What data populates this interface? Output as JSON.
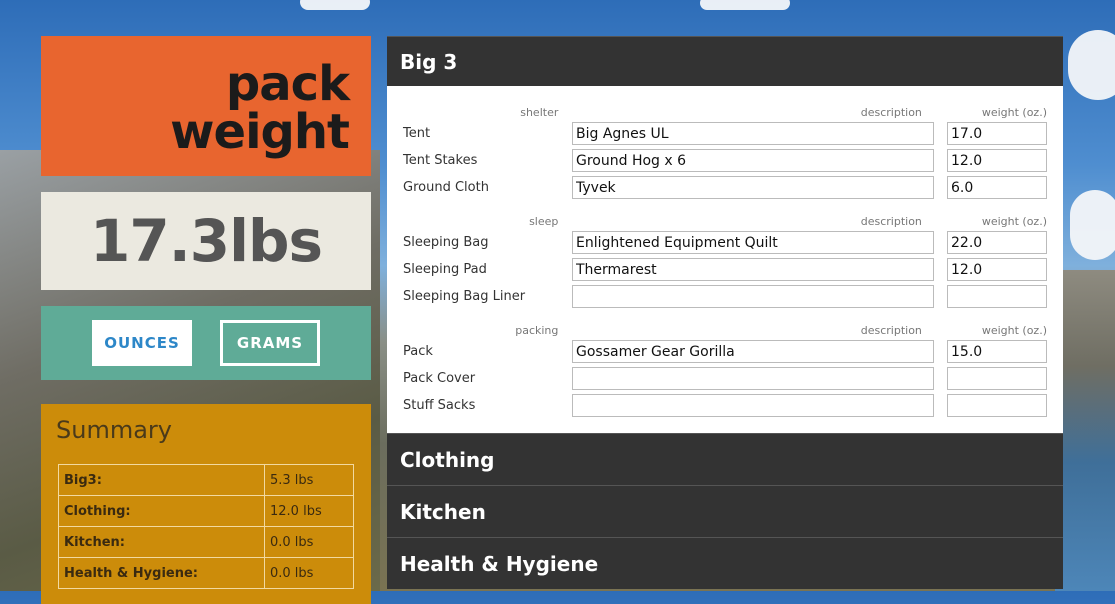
{
  "logo": {
    "line1": "pack",
    "line2": "weight"
  },
  "total": "17.3lbs",
  "units": {
    "ounces": "OUNCES",
    "grams": "GRAMS"
  },
  "summary": {
    "title": "Summary",
    "rows": [
      {
        "label": "Big3:",
        "value": "5.3 lbs"
      },
      {
        "label": "Clothing:",
        "value": "12.0 lbs"
      },
      {
        "label": "Kitchen:",
        "value": "0.0 lbs"
      },
      {
        "label": "Health & Hygiene:",
        "value": "0.0 lbs"
      }
    ]
  },
  "sections": [
    {
      "title": "Big 3",
      "groups": [
        {
          "category": "shelter",
          "desc_header": "description",
          "weight_header": "weight (oz.)",
          "items": [
            {
              "name": "Tent",
              "description": "Big Agnes UL",
              "weight": "17.0"
            },
            {
              "name": "Tent Stakes",
              "description": "Ground Hog x 6",
              "weight": "12.0"
            },
            {
              "name": "Ground Cloth",
              "description": "Tyvek",
              "weight": "6.0"
            }
          ]
        },
        {
          "category": "sleep",
          "desc_header": "description",
          "weight_header": "weight (oz.)",
          "items": [
            {
              "name": "Sleeping Bag",
              "description": "Enlightened Equipment Quilt",
              "weight": "22.0"
            },
            {
              "name": "Sleeping Pad",
              "description": "Thermarest",
              "weight": "12.0"
            },
            {
              "name": "Sleeping Bag Liner",
              "description": "",
              "weight": ""
            }
          ]
        },
        {
          "category": "packing",
          "desc_header": "description",
          "weight_header": "weight (oz.)",
          "items": [
            {
              "name": "Pack",
              "description": "Gossamer Gear Gorilla",
              "weight": "15.0"
            },
            {
              "name": "Pack Cover",
              "description": "",
              "weight": ""
            },
            {
              "name": "Stuff Sacks",
              "description": "",
              "weight": ""
            }
          ]
        }
      ]
    },
    {
      "title": "Clothing"
    },
    {
      "title": "Kitchen"
    },
    {
      "title": "Health & Hygiene"
    }
  ]
}
